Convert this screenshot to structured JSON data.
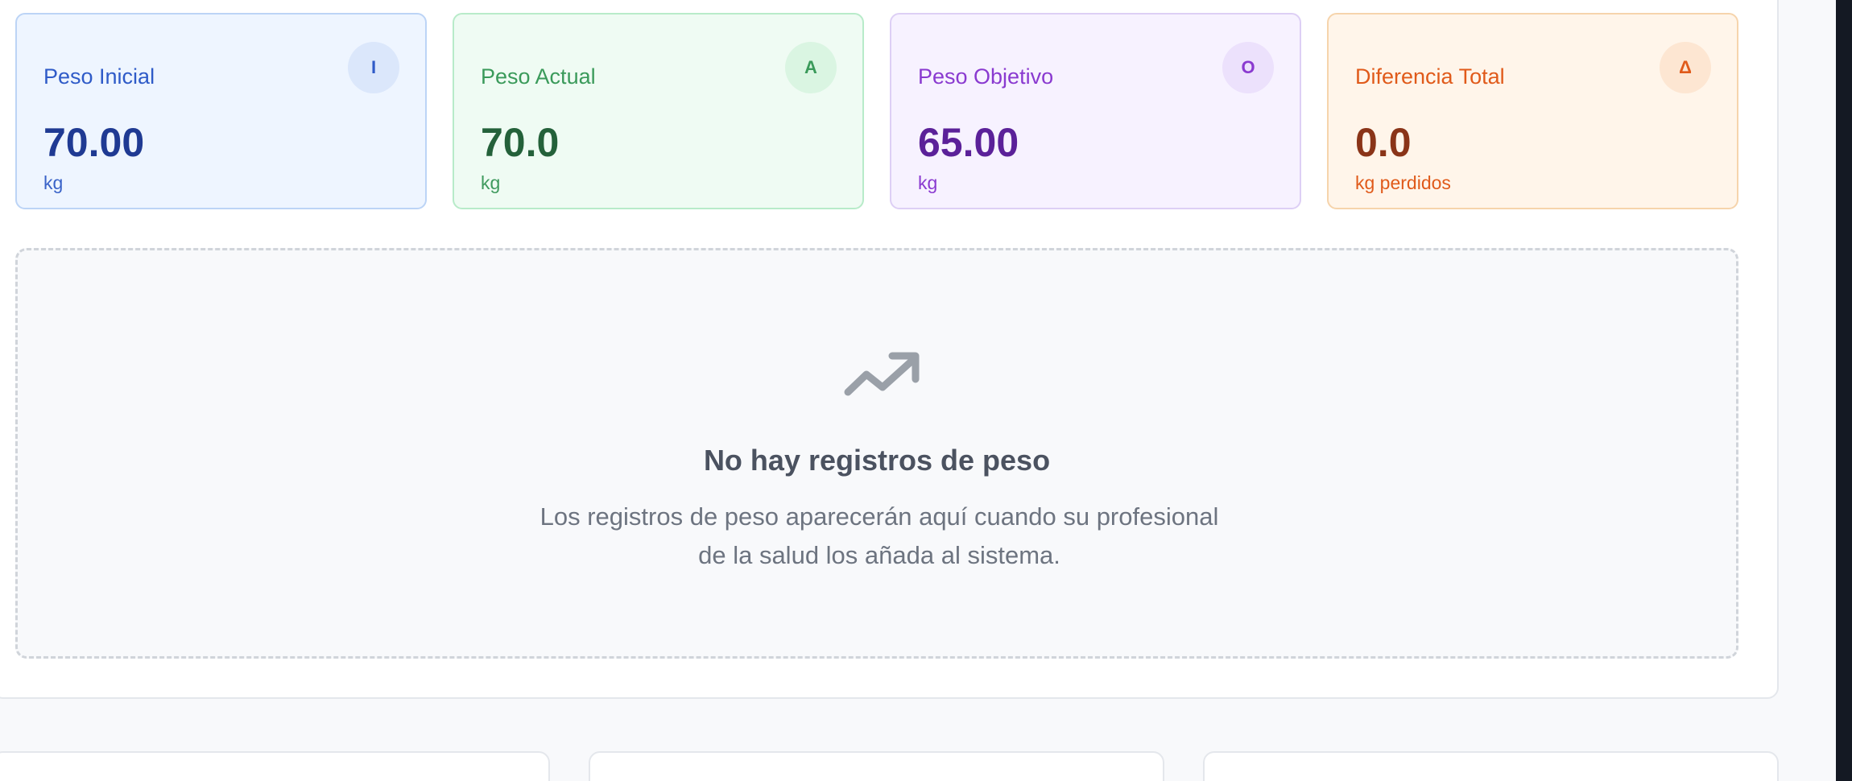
{
  "stats": [
    {
      "label": "Peso Inicial",
      "badge": "I",
      "value": "70.00",
      "unit": "kg"
    },
    {
      "label": "Peso Actual",
      "badge": "A",
      "value": "70.0",
      "unit": "kg"
    },
    {
      "label": "Peso Objetivo",
      "badge": "O",
      "value": "65.00",
      "unit": "kg"
    },
    {
      "label": "Diferencia Total",
      "badge": "Δ",
      "value": "0.0",
      "unit": "kg perdidos"
    }
  ],
  "empty_state": {
    "icon": "trending-up-icon",
    "title": "No hay registros de peso",
    "description_line1": "Los registros de peso aparecerán aquí cuando su profesional",
    "description_line2": "de la salud los añada al sistema."
  },
  "colors": {
    "blue": "#2f5bc8",
    "green": "#3a9a5a",
    "purple": "#8a3ad0",
    "orange": "#e05a1a",
    "icon_gray": "#9aa0a8"
  }
}
